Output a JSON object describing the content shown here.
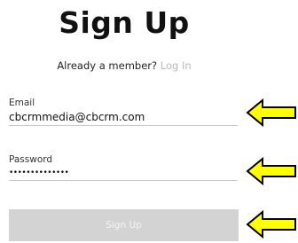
{
  "header": {
    "title": "Sign Up"
  },
  "member_prompt": {
    "text": "Already a member?",
    "link_label": "Log In"
  },
  "email": {
    "label": "Email",
    "value": "cbcrmmedia@cbcrm.com"
  },
  "password": {
    "label": "Password",
    "value": "••••••••••••••"
  },
  "submit": {
    "label": "Sign Up"
  },
  "annotations": {
    "arrow_color": "#ffff00",
    "arrow_outline": "#000000"
  }
}
